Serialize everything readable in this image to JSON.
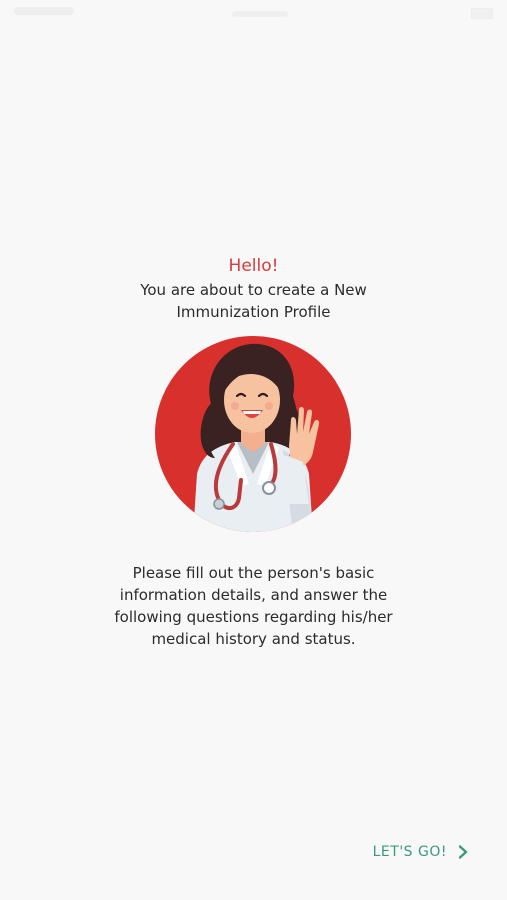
{
  "greeting": "Hello!",
  "intro": "You are about to create a New Immunization Profile",
  "description": "Please fill out the person's basic information details, and answer the following questions regarding his/her medical history and status.",
  "action": {
    "label": "LET'S GO!",
    "icon": "chevron-right-icon"
  },
  "colors": {
    "accent_red": "#d83b3b",
    "action_green": "#3a9a80",
    "illustration_red": "#d8302c"
  }
}
